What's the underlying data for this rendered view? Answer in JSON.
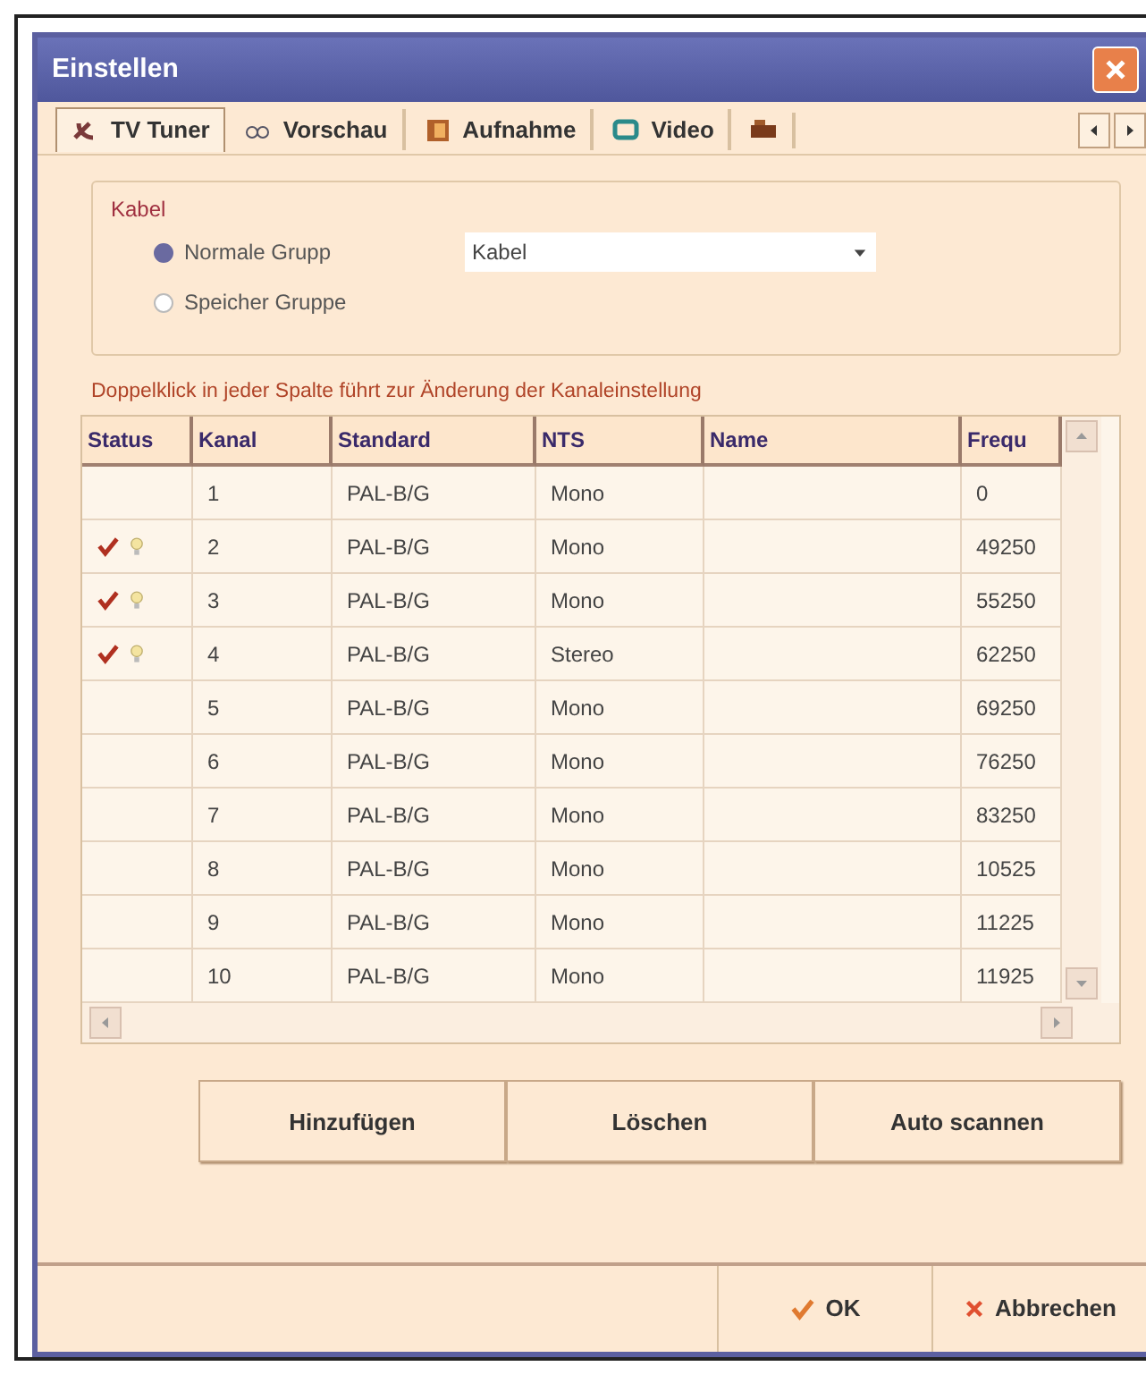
{
  "window": {
    "title": "Einstellen"
  },
  "tabs": [
    {
      "label": "TV Tuner",
      "selected": true,
      "kind": "tuner"
    },
    {
      "label": "Vorschau",
      "selected": false,
      "kind": "preview"
    },
    {
      "label": "Aufnahme",
      "selected": false,
      "kind": "record"
    },
    {
      "label": "Video",
      "selected": false,
      "kind": "video"
    },
    {
      "selected": false,
      "kind": "more"
    }
  ],
  "group": {
    "title": "Kabel",
    "options": [
      {
        "label": "Normale Grupp",
        "selected": true
      },
      {
        "label": "Speicher Gruppe",
        "selected": false
      }
    ],
    "dropdown": {
      "value": "Kabel"
    }
  },
  "hint": "Doppelklick in jeder Spalte führt zur Änderung der Kanaleinstellung",
  "table": {
    "columns": [
      "Status",
      "Kanal",
      "Standard",
      "NTS",
      "Name",
      "Frequ"
    ],
    "rows": [
      {
        "active": false,
        "kanal": "1",
        "standard": "PAL-B/G",
        "nts": "Mono",
        "name": "",
        "frequ": "0"
      },
      {
        "active": true,
        "kanal": "2",
        "standard": "PAL-B/G",
        "nts": "Mono",
        "name": "",
        "frequ": "49250"
      },
      {
        "active": true,
        "kanal": "3",
        "standard": "PAL-B/G",
        "nts": "Mono",
        "name": "",
        "frequ": "55250"
      },
      {
        "active": true,
        "kanal": "4",
        "standard": "PAL-B/G",
        "nts": "Stereo",
        "name": "",
        "frequ": "62250"
      },
      {
        "active": false,
        "kanal": "5",
        "standard": "PAL-B/G",
        "nts": "Mono",
        "name": "",
        "frequ": "69250"
      },
      {
        "active": false,
        "kanal": "6",
        "standard": "PAL-B/G",
        "nts": "Mono",
        "name": "",
        "frequ": "76250"
      },
      {
        "active": false,
        "kanal": "7",
        "standard": "PAL-B/G",
        "nts": "Mono",
        "name": "",
        "frequ": "83250"
      },
      {
        "active": false,
        "kanal": "8",
        "standard": "PAL-B/G",
        "nts": "Mono",
        "name": "",
        "frequ": "10525"
      },
      {
        "active": false,
        "kanal": "9",
        "standard": "PAL-B/G",
        "nts": "Mono",
        "name": "",
        "frequ": "11225"
      },
      {
        "active": false,
        "kanal": "10",
        "standard": "PAL-B/G",
        "nts": "Mono",
        "name": "",
        "frequ": "11925"
      }
    ]
  },
  "buttons": [
    "Hinzufügen",
    "Löschen",
    "Auto scannen"
  ],
  "footer": [
    {
      "label": "OK",
      "kind": "ok"
    },
    {
      "label": "Abbrechen",
      "kind": "cancel"
    }
  ]
}
